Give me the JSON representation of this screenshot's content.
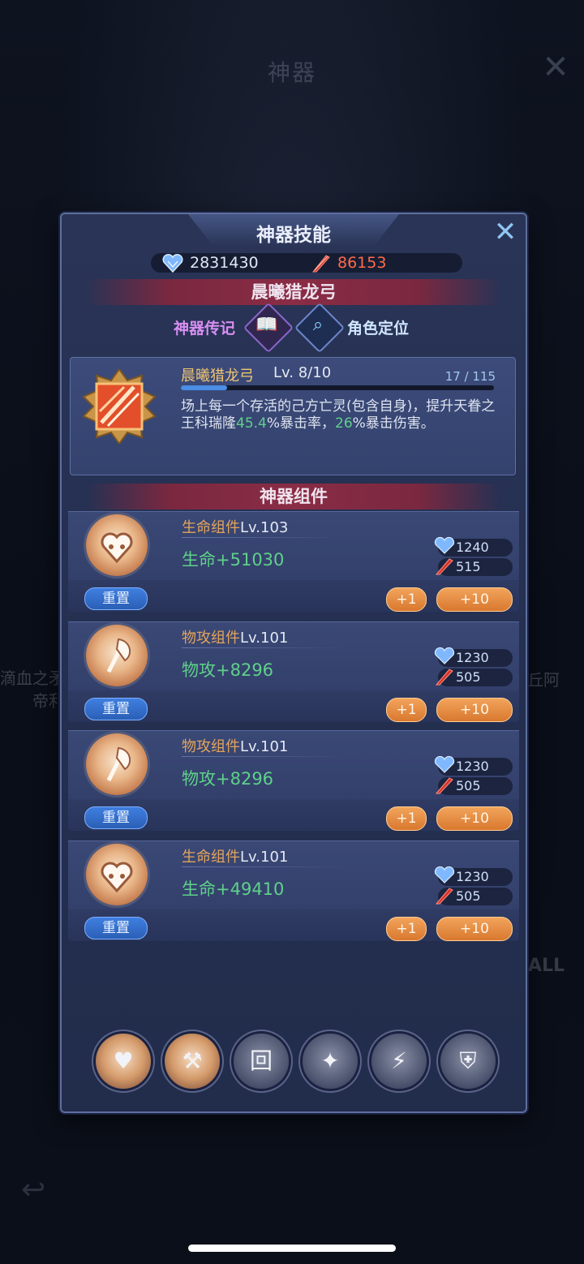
{
  "background": {
    "title": "神器",
    "left_text_line1": "滴血之矛",
    "left_text_line2": "帝利",
    "right_text": "丘阿",
    "all_label": "ALL"
  },
  "panel": {
    "title": "神器技能",
    "close_icon": "close-x-icon"
  },
  "resources": {
    "blue": {
      "icon": "blue-heart-crystal-icon",
      "value": "2831430",
      "color": "#7fb8ff"
    },
    "red": {
      "icon": "red-feather-quill-icon",
      "value": "86153",
      "color": "#ff6a4a"
    }
  },
  "artifact": {
    "name": "晨曦猎龙弓",
    "tabs": [
      {
        "label": "神器传记",
        "icon": "book-icon"
      },
      {
        "label": "角色定位",
        "icon": "magnifier-icon"
      }
    ]
  },
  "skill": {
    "icon": "light-slash-skill-icon",
    "name": "晨曦猎龙弓",
    "level": "Lv. 8/10",
    "exp": "17 / 115",
    "exp_fraction": 0.148,
    "desc_part1": "场上每一个存活的己方亡灵(包含自身)，提升天眷之王科瑞隆",
    "desc_hl1": "45.4",
    "desc_part2": "%暴击率，",
    "desc_hl2": "26",
    "desc_part3": "%暴击伤害。"
  },
  "components_header": "神器组件",
  "components": [
    {
      "icon": "heart-icon",
      "title": "生命组件",
      "level": "Lv.103",
      "stat": "生命+51030",
      "cost_blue": "1240",
      "cost_red": "515",
      "reset": "重置",
      "plus1": "+1",
      "plus10": "+10"
    },
    {
      "icon": "axe-icon",
      "title": "物攻组件",
      "level": "Lv.101",
      "stat": "物攻+8296",
      "cost_blue": "1230",
      "cost_red": "505",
      "reset": "重置",
      "plus1": "+1",
      "plus10": "+10"
    },
    {
      "icon": "axe-icon",
      "title": "物攻组件",
      "level": "Lv.101",
      "stat": "物攻+8296",
      "cost_blue": "1230",
      "cost_red": "505",
      "reset": "重置",
      "plus1": "+1",
      "plus10": "+10"
    },
    {
      "icon": "heart-icon",
      "title": "生命组件",
      "level": "Lv.101",
      "stat": "生命+49410",
      "cost_blue": "1230",
      "cost_red": "505",
      "reset": "重置",
      "plus1": "+1",
      "plus10": "+10"
    }
  ],
  "bottom_tabs": [
    {
      "icon": "heart-icon",
      "glyph": "♥",
      "active": true
    },
    {
      "icon": "axe-icon",
      "glyph": "⚒",
      "active": true
    },
    {
      "icon": "rune-icon",
      "glyph": "回",
      "active": false
    },
    {
      "icon": "flame-shield-icon",
      "glyph": "✦",
      "active": false
    },
    {
      "icon": "lightning-icon",
      "glyph": "⚡",
      "active": false
    },
    {
      "icon": "shield-plus-icon",
      "glyph": "⛨",
      "active": false
    }
  ]
}
